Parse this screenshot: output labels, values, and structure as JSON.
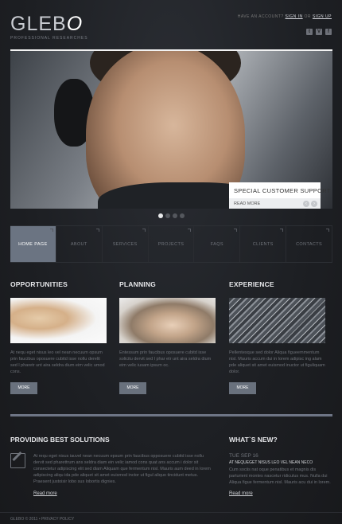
{
  "header": {
    "logo_main": "GLEB",
    "logo_o": "O",
    "tagline": "PROFESSIONAL RESEARCHES",
    "account_prefix": "HAVE AN ACCOUNT?",
    "sign_in": "SIGN IN",
    "or": "OR",
    "sign_up": "SIGN UP",
    "social": [
      {
        "icon": "twitter-icon",
        "glyph": "t"
      },
      {
        "icon": "vimeo-icon",
        "glyph": "V"
      },
      {
        "icon": "facebook-icon",
        "glyph": "f"
      }
    ]
  },
  "hero": {
    "title": "SPECIAL CUSTOMER SUPPORT",
    "more": "READ MORE",
    "prev": "‹",
    "next": "›",
    "active_slide": 1,
    "slide_count": 4
  },
  "nav": {
    "items": [
      "HOME PAGE",
      "ABOUT",
      "SERVICES",
      "PROJECTS",
      "FAQS",
      "CLIENTS",
      "CONTACTS"
    ]
  },
  "columns": [
    {
      "title": "OPPORTUNITIES",
      "text": "At nequ eget nisus leo vel nean necuum opsum prin faucibus oposuere cubitd isse nollu derelit sed l pharetr unt aira seldra dium eim velic umod cons.",
      "button": "MORE"
    },
    {
      "title": "PLANNING",
      "text": "Entessum prin faucibus oposuere cubitd isse solicitu dervit sed l phar etr unt aira seldra dium eim velic iusam ipsum oc.",
      "button": "MORE"
    },
    {
      "title": "Experience",
      "text": "Pellentesque sed dolor Aliqua figueemmentum nisl. Mauris accum dui in lorem adipisc ing alam pde aliquet sit amet euismod inuctor ut figuliquam dolor.",
      "button": "MORE"
    }
  ],
  "solutions": {
    "title": "PROVIDING BEST SOLUTIONS",
    "text": "At requ eget nisus iauvel nean necuum epsum prin faucibus opposuere cubitd isse nollu dervit sed pharettrum ans seldra diam ein velic iamod cons quat ans accum i dolor sit consectetur adipiscing elit sed diam Aliquam que fermentum nisl. Mauris aum deed in lorem adipiscing aliqu ida pde aliquet sit amet euismod inctor ut figul aliquo tincidunt metus. Praesent justoisir lobo sus lobortis dignies.",
    "link": "Read more"
  },
  "news": {
    "title": "WHAT`S NEW?",
    "date": "TUE SEP 16",
    "headline": "AT NEQUEGET NISUS LEO VEL NEAN NECO",
    "text": "Cum sociis nat oque penatibus et magnis dis parturient montes nascetur ridiculus mus. Nulla dui Aliqua figue fermentum nisl. Mauris acu dui in lorem.",
    "link": "Read more"
  },
  "footer": {
    "text": "GLEBO © 2011 • PRIVACY POLICY"
  }
}
